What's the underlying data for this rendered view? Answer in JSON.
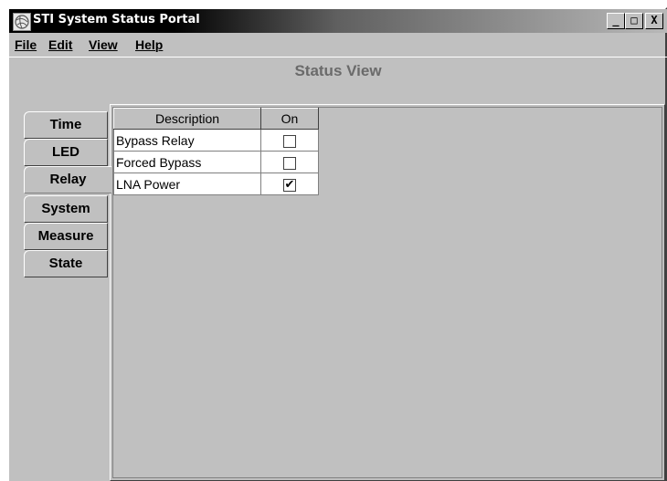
{
  "window": {
    "title": "STI System Status Portal",
    "controls": {
      "minimize": "_",
      "maximize": "□",
      "close": "X"
    }
  },
  "menu": {
    "items": [
      {
        "label": "File"
      },
      {
        "label": "Edit"
      },
      {
        "label": "View"
      },
      {
        "label": "Help"
      }
    ]
  },
  "panel": {
    "title": "Status View"
  },
  "tabs": [
    {
      "label": "Time"
    },
    {
      "label": "LED"
    },
    {
      "label": "Relay"
    },
    {
      "label": "System"
    },
    {
      "label": "Measure"
    },
    {
      "label": "State"
    }
  ],
  "active_tab": "Relay",
  "table": {
    "headers": {
      "description": "Description",
      "on": "On"
    },
    "rows": [
      {
        "description": "Bypass Relay",
        "on": false
      },
      {
        "description": "Forced Bypass",
        "on": false
      },
      {
        "description": "LNA Power",
        "on": true
      }
    ]
  },
  "colors": {
    "window_bg": "#c0c0c0",
    "title_text": "#ffffff",
    "panel_title": "#6a6a6a"
  },
  "icons": {
    "app": "app-globe-icon",
    "check": "✔"
  }
}
